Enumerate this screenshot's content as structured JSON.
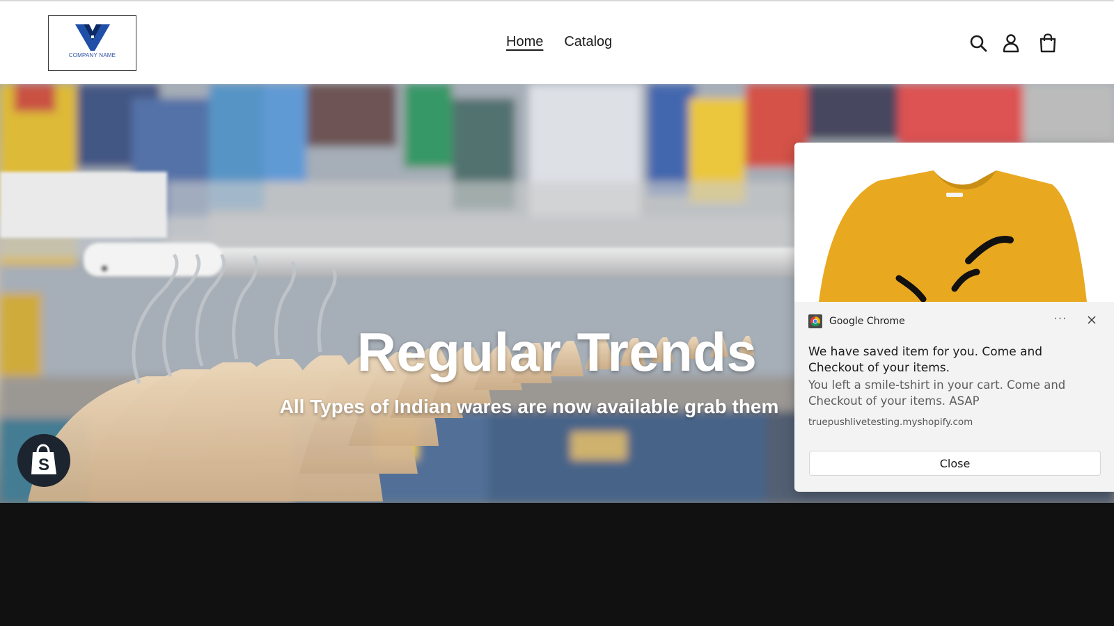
{
  "header": {
    "logo_text": "COMPANY NAME",
    "nav": [
      {
        "label": "Home",
        "active": true
      },
      {
        "label": "Catalog",
        "active": false
      }
    ],
    "icons": [
      "search-icon",
      "account-icon",
      "cart-icon"
    ]
  },
  "hero": {
    "title": "Regular Trends",
    "subtitle": "All Types of Indian wares are now available grab them"
  },
  "notification": {
    "app_name": "Google Chrome",
    "menu_label": "···",
    "title": "We have saved item for you. Come and Checkout of your items.",
    "body": "You left a smile-tshirt in your cart. Come and Checkout of your items. ASAP",
    "url": "truepushlivetesting.myshopify.com",
    "button_label": "Close"
  },
  "colors": {
    "logo_blue": "#1f4fa8",
    "tshirt_yellow": "#e8a820",
    "notification_bg": "#f3f3f3",
    "footer_bg": "#111112"
  }
}
